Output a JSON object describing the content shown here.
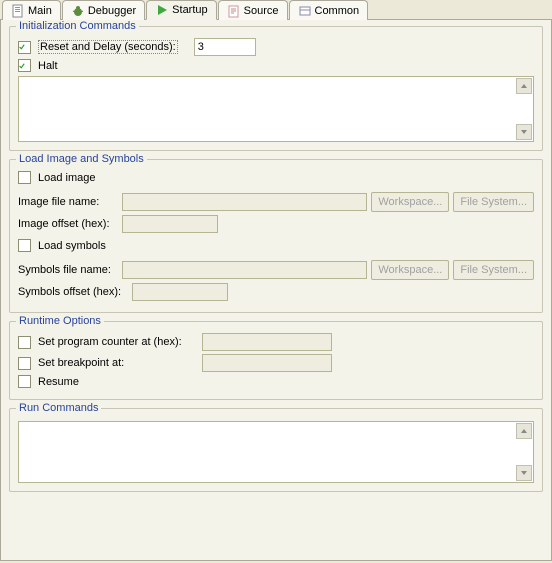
{
  "tabs": {
    "main": "Main",
    "debugger": "Debugger",
    "startup": "Startup",
    "source": "Source",
    "common": "Common"
  },
  "init": {
    "title": "Initialization Commands",
    "reset_label": "Reset and Delay (seconds):",
    "reset_checked": true,
    "reset_value": "3",
    "halt_label": "Halt",
    "halt_checked": true,
    "commands": ""
  },
  "load": {
    "title": "Load Image and Symbols",
    "load_image_label": "Load image",
    "load_image_checked": false,
    "image_file_label": "Image file name:",
    "image_file_value": "",
    "image_offset_label": "Image offset (hex):",
    "image_offset_value": "",
    "load_symbols_label": "Load symbols",
    "load_symbols_checked": false,
    "symbols_file_label": "Symbols file name:",
    "symbols_file_value": "",
    "symbols_offset_label": "Symbols offset (hex):",
    "symbols_offset_value": "",
    "workspace_btn": "Workspace...",
    "filesystem_btn": "File System..."
  },
  "runtime": {
    "title": "Runtime Options",
    "pc_label": "Set program counter at (hex):",
    "pc_checked": false,
    "pc_value": "",
    "bp_label": "Set breakpoint at:",
    "bp_checked": false,
    "bp_value": "",
    "resume_label": "Resume",
    "resume_checked": false
  },
  "run": {
    "title": "Run Commands",
    "commands": ""
  }
}
